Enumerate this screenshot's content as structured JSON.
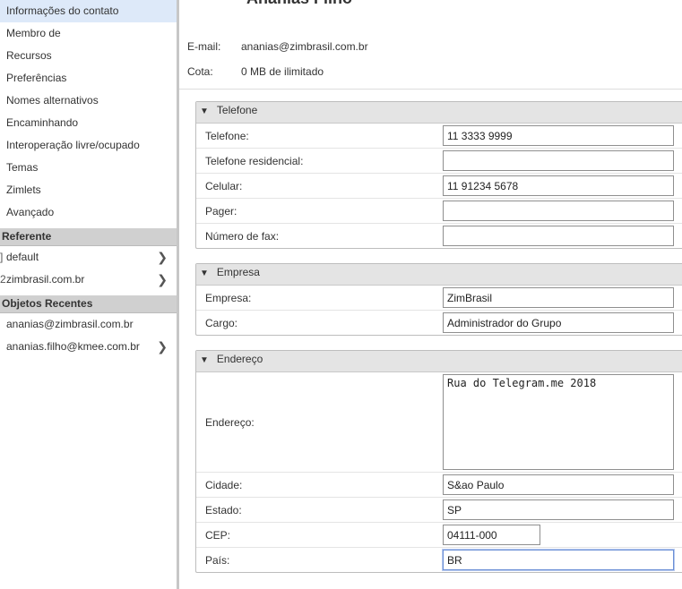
{
  "sidebar": {
    "items": [
      {
        "label": "Informações do contato",
        "active": true
      },
      {
        "label": "Membro de"
      },
      {
        "label": "Recursos"
      },
      {
        "label": "Preferências"
      },
      {
        "label": "Nomes alternativos"
      },
      {
        "label": "Encaminhando"
      },
      {
        "label": "Interoperação livre/ocupado"
      },
      {
        "label": "Temas"
      },
      {
        "label": "Zimlets"
      },
      {
        "label": "Avançado"
      }
    ],
    "referente": {
      "header": "Referente",
      "items": [
        {
          "label": "default",
          "edge_glyph": "]"
        },
        {
          "label": "zimbrasil.com.br",
          "edge_glyph": "2"
        }
      ]
    },
    "recentes": {
      "header": "Objetos Recentes",
      "items": [
        {
          "label": "ananias@zimbrasil.com.br"
        },
        {
          "label": "ananias.filho@kmee.com.br"
        }
      ]
    }
  },
  "main": {
    "title": "Ananias Filho",
    "email_label": "E-mail:",
    "email_value": "ananias@zimbrasil.com.br",
    "quota_label": "Cota:",
    "quota_value": "0 MB de ilimitado"
  },
  "telefone": {
    "header": "Telefone",
    "rows": [
      {
        "label": "Telefone:",
        "value": "11 3333 9999"
      },
      {
        "label": "Telefone residencial:",
        "value": ""
      },
      {
        "label": "Celular:",
        "value": "11 91234 5678"
      },
      {
        "label": "Pager:",
        "value": ""
      },
      {
        "label": "Número de fax:",
        "value": ""
      }
    ]
  },
  "empresa": {
    "header": "Empresa",
    "rows": [
      {
        "label": "Empresa:",
        "value": "ZimBrasil"
      },
      {
        "label": "Cargo:",
        "value": "Administrador do Grupo"
      }
    ]
  },
  "endereco": {
    "header": "Endereço",
    "address_label": "Endereço:",
    "address_value": "Rua do Telegram.me 2018",
    "rows": [
      {
        "label": "Cidade:",
        "value": "S&ao Paulo"
      },
      {
        "label": "Estado:",
        "value": "SP"
      },
      {
        "label": "CEP:",
        "value": "04111-000"
      },
      {
        "label": "País:",
        "value": "BR"
      }
    ]
  },
  "icons": {
    "collapse": "triangle-down-icon",
    "chevron": "chevron-right-icon"
  }
}
